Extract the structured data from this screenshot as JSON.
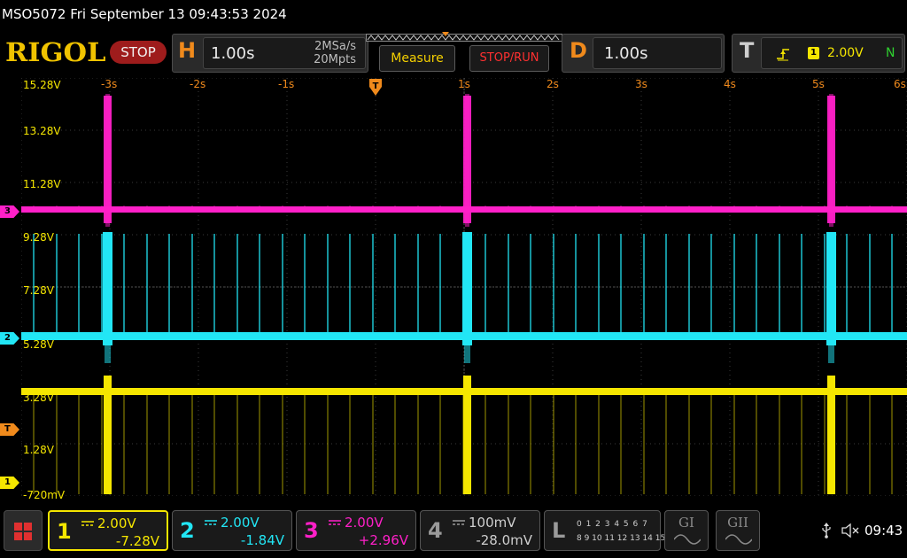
{
  "header": {
    "title_line": "MSO5072  Fri September 13 09:43:53 2024"
  },
  "toolbar": {
    "logo": "RIGOL",
    "run_state": "STOP",
    "horizontal": {
      "letter": "H",
      "scale": "1.00s",
      "sample_rate": "2MSa/s",
      "memory_depth": "20Mpts"
    },
    "measure_label": "Measure",
    "stop_run_label": "STOP/RUN",
    "delayed": {
      "letter": "D",
      "scale": "1.00s"
    },
    "trigger": {
      "letter": "T",
      "source": "1",
      "level": "2.00V",
      "sweep": "N",
      "edge_icon": "rising-edge-trigger-icon"
    }
  },
  "grid": {
    "time_labels": [
      "-3s",
      "-2s",
      "-1s",
      "1s",
      "2s",
      "3s",
      "4s",
      "5s",
      "6s"
    ],
    "volt_labels": [
      "15.28V",
      "13.28V",
      "11.28V",
      "9.28V",
      "7.28V",
      "5.28V",
      "3.28V",
      "1.28V",
      "-720mV"
    ],
    "markers": {
      "ch3": "3",
      "ch2": "2",
      "trigger": "T",
      "ch1": "1"
    }
  },
  "channels": [
    {
      "num": "1",
      "scale": "2.00V",
      "offset": "-7.28V",
      "color": "#f5e600",
      "active": true
    },
    {
      "num": "2",
      "scale": "2.00V",
      "offset": "-1.84V",
      "color": "#22e6f5"
    },
    {
      "num": "3",
      "scale": "2.00V",
      "offset": "+2.96V",
      "color": "#ff20c8"
    },
    {
      "num": "4",
      "scale": "100mV",
      "offset": "-28.0mV",
      "color": "#9a9a9a"
    }
  ],
  "logic_analyzer": {
    "letter": "L",
    "row1": "0 1 2 3  4 5 6 7",
    "row2": "8 9 10 11 12 13 14 15"
  },
  "generators": [
    {
      "label": "GI"
    },
    {
      "label": "GII"
    }
  ],
  "status": {
    "time": "09:43"
  },
  "colors": {
    "ch1": "#f5e600",
    "ch2": "#22e6f5",
    "ch3": "#ff20c8",
    "accent": "#f08a1c",
    "stop": "#9e1c1c"
  }
}
